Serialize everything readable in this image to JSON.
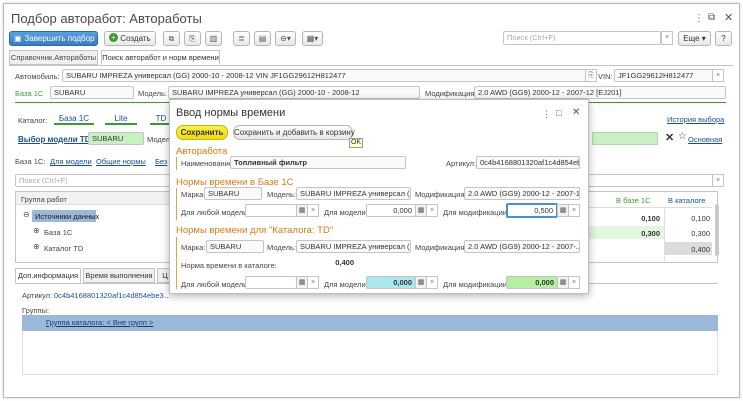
{
  "window": {
    "title": "Подбор авторабот: Автоработы",
    "controls": [
      "⋮",
      "⧉",
      "✕"
    ]
  },
  "toolbar": {
    "finish_label": "Завершить подбор",
    "create_label": "Создать",
    "search_placeholder": "Поиск (Ctrl+F)",
    "more_label": "Еще",
    "help_label": "?"
  },
  "tabs": [
    "Справочник.Автоработы",
    "Поиск авторабот и норм времени"
  ],
  "car": {
    "label": "Автомобиль:",
    "value": "SUBARU IMPREZA универсал (GG) 2000-10 - 2008-12 VIN JF1GG29612H812477",
    "vin_label": "VIN:",
    "vin_value": "JF1GG29612H812477"
  },
  "base_row": {
    "base_label": "База 1С",
    "base_value": "SUBARU",
    "model_label": "Модель:",
    "model_value": "SUBARU IMPREZA универсал (GG) 2000-10 - 2008-12",
    "mod_label": "Модификация:",
    "mod_value": "2.0 AWD (GG9) 2000-12 - 2007-12 [EJ201]"
  },
  "catalog": {
    "label": "Каталог:",
    "tabs": [
      "База 1С",
      "Lite",
      "TD"
    ],
    "history_link": "История выбора"
  },
  "model_td": {
    "link": "Выбор модели TD",
    "value": "SUBARU",
    "model_label": "Модел",
    "main_link": "Основная"
  },
  "filter": {
    "base_label": "База 1С:",
    "by_model": "Для модели",
    "common": "Общие нормы",
    "partial": "Без"
  },
  "search2_placeholder": "Поиск (Ctrl+F)",
  "tree": {
    "header": "Группа работ",
    "rows": [
      "Источники данных",
      "База 1С",
      "Каталог TD"
    ]
  },
  "right_table": {
    "col1": "В базе 1С",
    "col2": "В каталоге",
    "rows": [
      {
        "a": "0,100",
        "b": "0,100"
      },
      {
        "a": "0,300",
        "b": "0,300"
      },
      {
        "a": "",
        "b": "0,400"
      }
    ]
  },
  "bottom_tabs": [
    "Доп.информация",
    "Время выполнения",
    "Ц"
  ],
  "article": {
    "label": "Артикул:",
    "value": "0c4b4168801320af1c4d854ebe37ae0"
  },
  "groups": {
    "label": "Группы:",
    "row": "Группа каталога: < Вне групп >"
  },
  "dialog": {
    "title": "Ввод нормы времени",
    "controls": [
      "⋮",
      "□",
      "✕"
    ],
    "save_label": "Сохранить",
    "save_add_label": "Сохранить и добавить в корзину",
    "tooltip": "OK",
    "autowork": {
      "title": "Авторабота",
      "name_label": "Наименование:",
      "name_value": "Топливный фильтр",
      "article_label": "Артикул:",
      "article_value": "0c4b4168801320af1c4d854eb..."
    },
    "base": {
      "title": "Нормы времени в Базе 1С",
      "brand_label": "Марка:",
      "brand_value": "SUBARU",
      "model_label": "Модель:",
      "model_value": "SUBARU IMPREZA универсал (...",
      "mod_label": "Модификация:",
      "mod_value": "2.0 AWD (GG9) 2000-12 - 2007-1...",
      "any_label": "Для любой модели:",
      "any_value": "",
      "for_model_label": "Для модели:",
      "for_model_value": "0,000",
      "for_mod_label": "Для модификации:",
      "for_mod_value": "0,500"
    },
    "td": {
      "title": "Нормы времени для \"Каталога: TD\"",
      "brand_label": "Марка:",
      "brand_value": "SUBARU",
      "model_label": "Модель:",
      "model_value": "SUBARU IMPREZA универсал (...",
      "mod_label": "Модификация:",
      "mod_value": "2.0 AWD (GG9) 2000-12 - 2007-...",
      "norm_label": "Норма времени в каталоге:",
      "norm_value": "0,400",
      "any_label": "Для любой модели:",
      "any_value": "",
      "for_model_label": "Для модели:",
      "for_model_value": "0,000",
      "for_mod_label": "Для модификации:",
      "for_mod_value": "0,000"
    }
  },
  "colors": {
    "accent_green": "#3c9a2e",
    "section_orange": "#d77a0f",
    "cyan_field": "#a8e8ee",
    "green_field": "#b4f0a0",
    "primary_blue": "#4a8fd0",
    "save_yellow": "#f6e61c"
  }
}
